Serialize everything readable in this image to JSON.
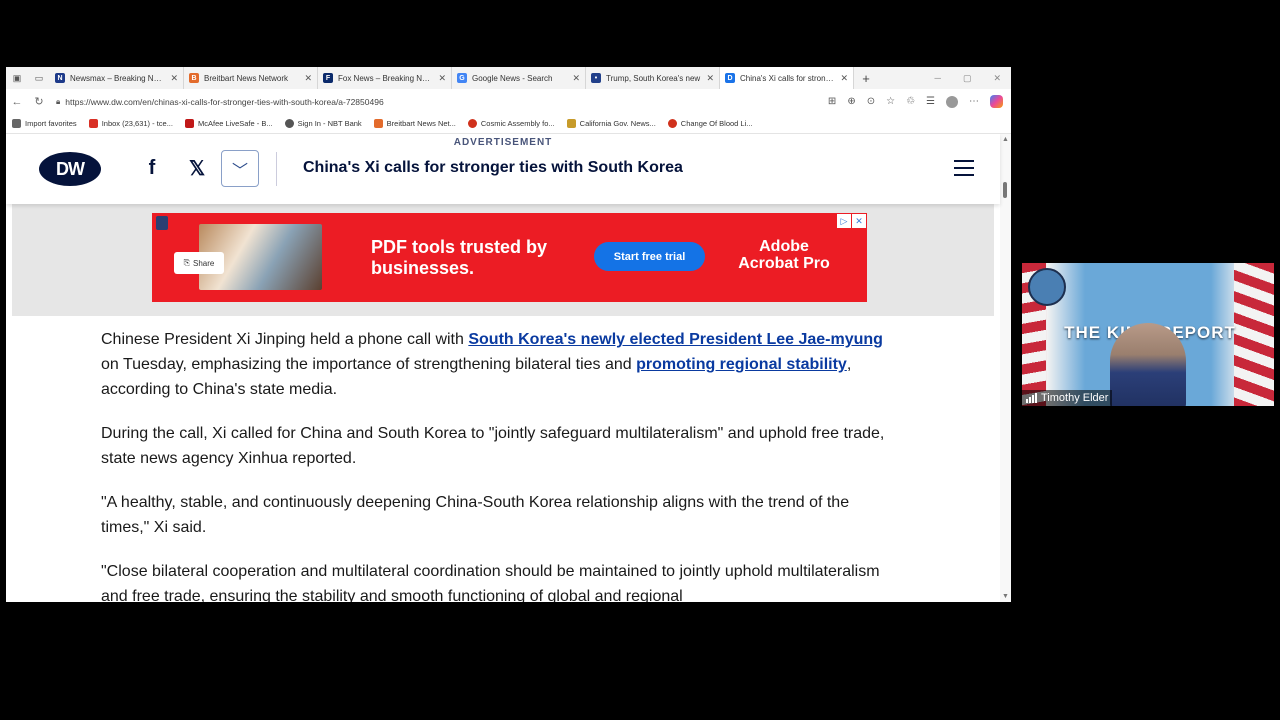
{
  "tabs": [
    {
      "title": "Newsmax – Breaking News",
      "favicon_color": "#1d3a8a",
      "favicon_letter": "N"
    },
    {
      "title": "Breitbart News Network",
      "favicon_color": "#e36b2c",
      "favicon_letter": "B"
    },
    {
      "title": "Fox News – Breaking News",
      "favicon_color": "#0b2a6b",
      "favicon_letter": "F"
    },
    {
      "title": "Google News - Search",
      "favicon_color": "#4285f4",
      "favicon_letter": "G"
    },
    {
      "title": "Trump, South Korea's new",
      "favicon_color": "#22408a",
      "favicon_letter": "•"
    },
    {
      "title": "China's Xi calls for stronger",
      "favicon_color": "#1a73e8",
      "favicon_letter": "D",
      "active": true
    }
  ],
  "address": {
    "url": "https://www.dw.com/en/chinas-xi-calls-for-stronger-ties-with-south-korea/a-72850496"
  },
  "favorites": [
    {
      "label": "Import favorites",
      "color": "#666"
    },
    {
      "label": "Inbox (23,631) - tce...",
      "color": "#d93025"
    },
    {
      "label": "McAfee LiveSafe - B...",
      "color": "#c01818"
    },
    {
      "label": "Sign In - NBT Bank",
      "color": "#555"
    },
    {
      "label": "Breitbart News Net...",
      "color": "#e36b2c"
    },
    {
      "label": "Cosmic Assembly fo...",
      "color": "#d0311c"
    },
    {
      "label": "California Gov. News...",
      "color": "#c79b2a"
    },
    {
      "label": "Change Of Blood Li...",
      "color": "#d0311c"
    }
  ],
  "header": {
    "logo": "DW",
    "headline": "China's Xi calls for stronger ties with South Korea"
  },
  "ad": {
    "label": "ADVERTISEMENT",
    "share": "Share",
    "headline": "PDF tools trusted by businesses.",
    "cta": "Start free trial",
    "brand": "Adobe Acrobat Pro"
  },
  "article": {
    "p1_pre": "Chinese President Xi Jinping held a phone call with ",
    "p1_link1": "South Korea's newly elected President Lee Jae-myung",
    "p1_mid": " on Tuesday, emphasizing the importance of strengthening bilateral ties and ",
    "p1_link2": "promoting regional stability",
    "p1_post": ", according to China's state media.",
    "p2": "During the call, Xi called for China and South Korea to \"jointly safeguard multilateralism\" and uphold free trade, state news agency Xinhua reported.",
    "p3": "\"A healthy, stable, and continuously deepening China-South Korea relationship aligns with the trend of the times,\" Xi said.",
    "p4": "\"Close bilateral cooperation and multilateral coordination should be maintained to jointly uphold multilateralism and free trade, ensuring the stability and smooth functioning of global and regional"
  },
  "webcam": {
    "overlay_text": "THE KING REPORT",
    "participant": "Timothy Elder"
  }
}
